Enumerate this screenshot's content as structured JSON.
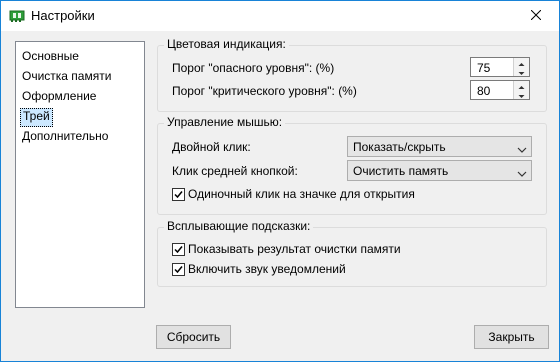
{
  "window": {
    "title": "Настройки",
    "accent": "#1883d7"
  },
  "nav": {
    "items": [
      {
        "label": "Основные"
      },
      {
        "label": "Очистка памяти"
      },
      {
        "label": "Оформление"
      },
      {
        "label": "Трей",
        "selected": true
      },
      {
        "label": "Дополнительно"
      }
    ]
  },
  "color_indication": {
    "title": "Цветовая индикация:",
    "danger_label": "Порог \"опасного уровня\": (%)",
    "danger_value": "75",
    "critical_label": "Порог \"критического уровня\": (%)",
    "critical_value": "80"
  },
  "mouse": {
    "title": "Управление мышью:",
    "double_click_label": "Двойной клик:",
    "double_click_value": "Показать/скрыть",
    "middle_click_label": "Клик средней кнопкой:",
    "middle_click_value": "Очистить память",
    "single_click_label": "Одиночный клик на значке для открытия",
    "single_click_checked": true
  },
  "tooltips": {
    "title": "Всплывающие подсказки:",
    "show_result_label": "Показывать результат очистки памяти",
    "show_result_checked": true,
    "sound_label": "Включить звук уведомлений",
    "sound_checked": true
  },
  "buttons": {
    "reset": "Сбросить",
    "close": "Закрыть"
  },
  "icons": {
    "app": "memory-chip-icon",
    "close": "close-icon",
    "spin_up": "spin-up-icon",
    "spin_down": "spin-down-icon",
    "dropdown": "chevron-down-icon",
    "check": "checkmark-icon"
  }
}
